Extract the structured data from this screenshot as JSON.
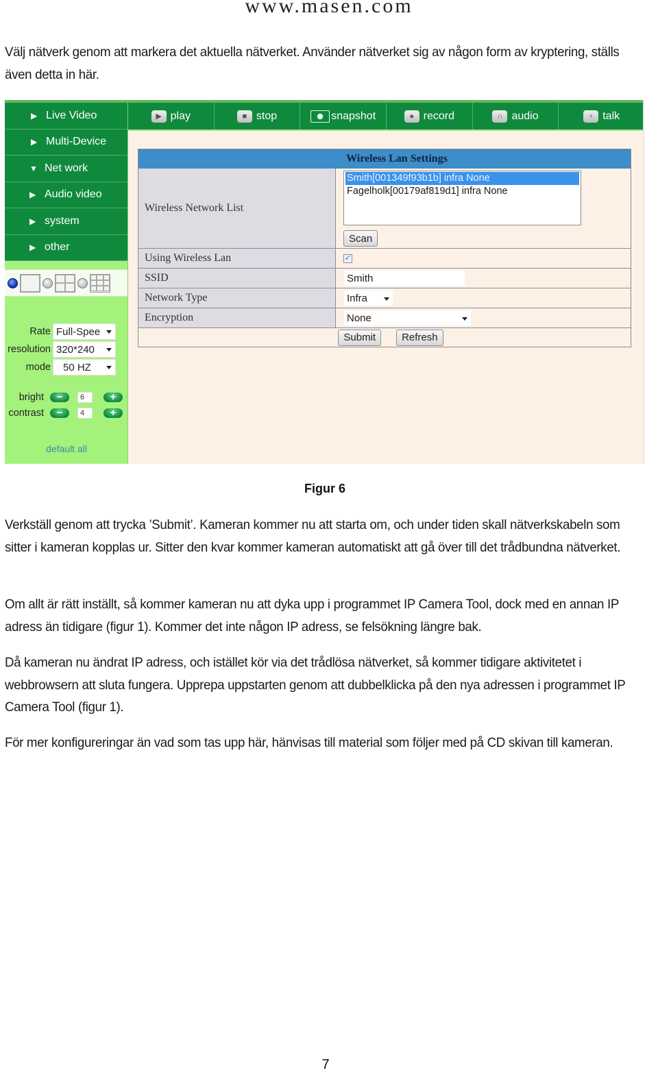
{
  "page": {
    "header": "www.masen.com",
    "intro": "Välj nätverk genom att markera det aktuella nätverket. Använder nätverket sig av någon form av kryptering, ställs även detta in här.",
    "caption": "Figur 6",
    "paragraphs": [
      "Verkställ genom att trycka ’Submit’. Kameran kommer nu att starta om, och under tiden skall nätverkskabeln som sitter i kameran kopplas ur. Sitter den kvar kommer kameran automatiskt att gå över till det trådbundna nätverket.",
      "Om allt är rätt inställt, så kommer kameran nu att dyka upp i programmet IP Camera Tool, dock med en annan IP adress än tidigare (figur 1).  Kommer det inte någon IP adress, se felsökning längre bak.",
      "Då kameran nu ändrat IP adress, och istället kör via det trådlösa nätverket, så kommer tidigare aktivitetet i webbrowsern att sluta fungera. Upprepa uppstarten genom att dubbelklicka på den nya adressen i programmet IP Camera Tool (figur 1).",
      "För mer konfigureringar än vad som tas upp här, hänvisas till material som följer med på CD skivan till kameran."
    ],
    "page_number": "7"
  },
  "camera_ui": {
    "sidebar": {
      "items": [
        {
          "label": "Live Video",
          "icon": "triangle-right",
          "expanded": false
        },
        {
          "label": "Multi-Device",
          "icon": "triangle-right",
          "expanded": false
        },
        {
          "label": "Net work",
          "icon": "triangle-down",
          "expanded": true
        },
        {
          "label": "Audio video",
          "icon": "triangle-right",
          "expanded": false
        },
        {
          "label": "system",
          "icon": "triangle-right",
          "expanded": false
        },
        {
          "label": "other",
          "icon": "triangle-right",
          "expanded": false
        }
      ],
      "arrow_right": "▶",
      "arrow_down": "▼",
      "layout_options": [
        "1-view",
        "4-view",
        "9-view"
      ],
      "layout_selected": "1-view",
      "controls": {
        "rate": {
          "label": "Rate",
          "value": "Full-Spee"
        },
        "resolution": {
          "label": "resolution",
          "value": "320*240"
        },
        "mode": {
          "label": "mode",
          "value": "50 HZ"
        },
        "bright": {
          "label": "bright",
          "value": "6"
        },
        "contrast": {
          "label": "contrast",
          "value": "4"
        },
        "minus": "−",
        "plus": "+"
      },
      "default_all": "default all"
    },
    "toolbar": [
      {
        "label": "play",
        "icon": "play-icon",
        "glyph": "▶"
      },
      {
        "label": "stop",
        "icon": "stop-icon",
        "glyph": "■"
      },
      {
        "label": "snapshot",
        "icon": "camera-icon",
        "glyph": ""
      },
      {
        "label": "record",
        "icon": "video-camera-icon",
        "glyph": "●"
      },
      {
        "label": "audio",
        "icon": "headphones-icon",
        "glyph": "∩"
      },
      {
        "label": "talk",
        "icon": "microphone-icon",
        "glyph": "♀"
      }
    ],
    "wireless": {
      "title": "Wireless Lan Settings",
      "network_list_label": "Wireless Network List",
      "networks": [
        {
          "text": "Smith[001349f93b1b] infra None",
          "selected": true
        },
        {
          "text": "Fagelholk[00179af819d1] infra None",
          "selected": false
        }
      ],
      "scan_label": "Scan",
      "using_label": "Using Wireless Lan",
      "using_checked": true,
      "check_glyph": "✓",
      "ssid_label": "SSID",
      "ssid_value": "Smith",
      "network_type_label": "Network Type",
      "network_type_value": "Infra",
      "encryption_label": "Encryption",
      "encryption_value": "None",
      "submit_label": "Submit",
      "refresh_label": "Refresh"
    }
  },
  "colors": {
    "nav_green": "#0f8a3d",
    "sidebar_light_green": "#a4f27c",
    "panel_title_blue": "#3c8dc8",
    "panel_bg": "#fdf1e6",
    "label_bg": "#dcdce2",
    "list_selected": "#3a92ea"
  }
}
